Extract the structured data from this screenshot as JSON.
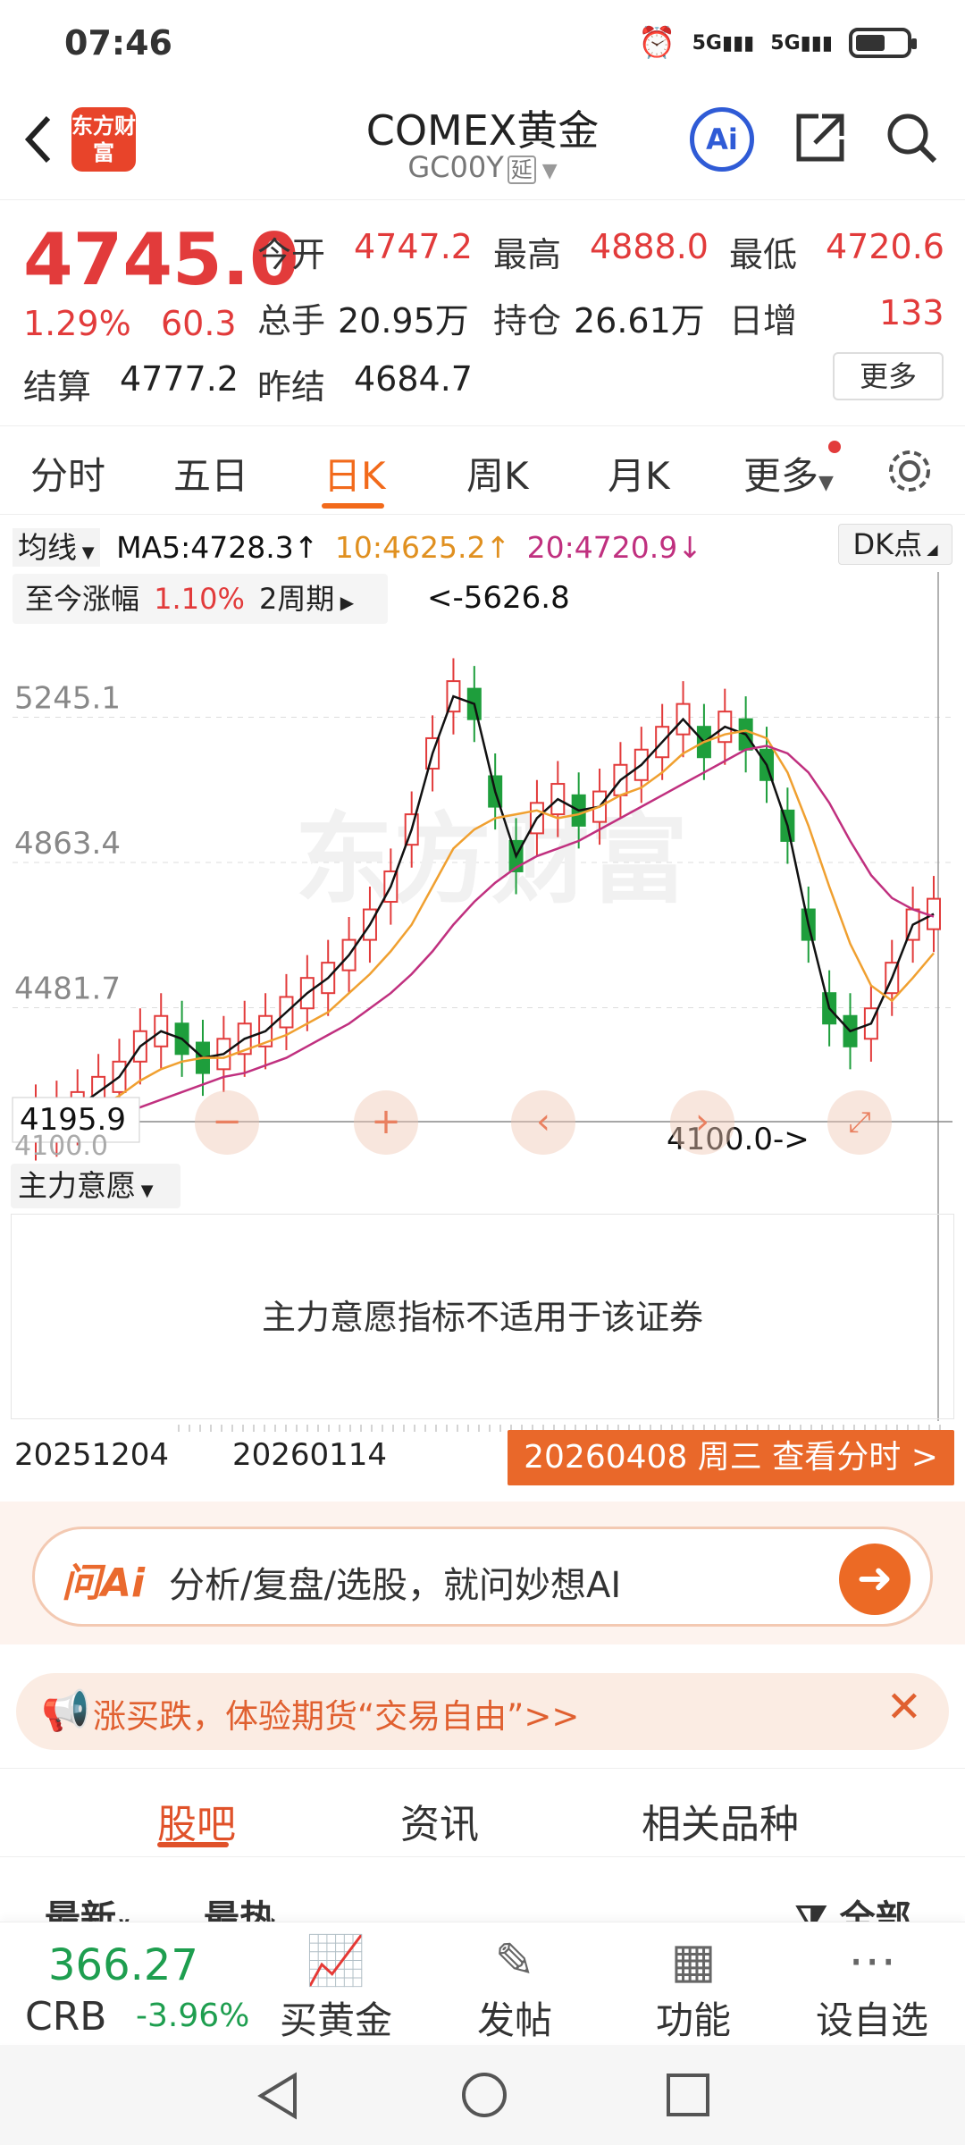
{
  "status_bar": {
    "time": "07:46",
    "network": "5G"
  },
  "nav": {
    "title": "COMEX黄金",
    "code": "GC00Y",
    "delay_tag": "延",
    "logo_text": "东方财富",
    "ai_label": "Ai"
  },
  "quote": {
    "price": "4745.0",
    "change_pct": "1.29%",
    "change": "60.3",
    "open_label": "今开",
    "open": "4747.2",
    "high_label": "最高",
    "high": "4888.0",
    "low_label": "最低",
    "low": "4720.6",
    "volume_label": "总手",
    "volume": "20.95万",
    "oi_label": "持仓",
    "oi": "26.61万",
    "daily_inc_label": "日增",
    "daily_inc": "133",
    "settle_label": "结算",
    "settle": "4777.2",
    "prev_settle_label": "昨结",
    "prev_settle": "4684.7",
    "more_label": "更多"
  },
  "period_tabs": [
    "分时",
    "五日",
    "日K",
    "周K",
    "月K",
    "更多"
  ],
  "active_period": "日K",
  "chart": {
    "ma_selector": "均线",
    "ma5": "MA5:4728.3",
    "ma10": "10:4625.2",
    "ma20": "20:4720.9",
    "dk_label": "DK点",
    "range_label": "至今涨幅",
    "range_pct": "1.10%",
    "range_period": "2周期",
    "max_annot": "<-5626.8",
    "min_annot": "4100.0->",
    "y_ticks": [
      "5245.1",
      "4863.4",
      "4481.7"
    ],
    "crosshair_value": "4195.9",
    "cut_tick": "4100.0",
    "colors": {
      "up": "#e23b3b",
      "down": "#1e9e3c",
      "ma5": "#111111",
      "ma10": "#f0a030",
      "ma20": "#c0307f"
    }
  },
  "chart_data": {
    "type": "candlestick",
    "title": "",
    "ylim": [
      4100.0,
      5626.8
    ],
    "series": [
      {
        "name": "MA5",
        "values": [
          4180,
          4190,
          4220,
          4260,
          4300,
          4380,
          4420,
          4400,
          4350,
          4360,
          4400,
          4420,
          4470,
          4520,
          4560,
          4620,
          4700,
          4800,
          4950,
          5150,
          5300,
          5280,
          5050,
          4880,
          4980,
          5030,
          5000,
          5010,
          5080,
          5120,
          5180,
          5240,
          5180,
          5220,
          5200,
          5120,
          4960,
          4700,
          4480,
          4420,
          4440,
          4560,
          4700,
          4728
        ]
      },
      {
        "name": "10",
        "values": [
          4150,
          4170,
          4190,
          4220,
          4250,
          4290,
          4320,
          4340,
          4350,
          4350,
          4370,
          4390,
          4410,
          4440,
          4470,
          4520,
          4570,
          4630,
          4700,
          4800,
          4900,
          4950,
          4980,
          4990,
          5000,
          4980,
          4990,
          5010,
          5040,
          5060,
          5100,
          5150,
          5180,
          5200,
          5210,
          5190,
          5100,
          4960,
          4800,
          4650,
          4540,
          4500,
          4560,
          4625
        ]
      },
      {
        "name": "20",
        "values": [
          4130,
          4140,
          4160,
          4180,
          4200,
          4220,
          4240,
          4260,
          4280,
          4300,
          4310,
          4330,
          4350,
          4380,
          4410,
          4440,
          4480,
          4520,
          4570,
          4630,
          4700,
          4760,
          4810,
          4850,
          4880,
          4900,
          4920,
          4950,
          4980,
          5010,
          5040,
          5070,
          5100,
          5130,
          5160,
          5170,
          5150,
          5100,
          5020,
          4920,
          4830,
          4770,
          4740,
          4721
        ]
      }
    ]
  },
  "indicator": {
    "selector": "主力意愿",
    "message": "主力意愿指标不适用于该证券"
  },
  "date_bar": {
    "start": "20251204",
    "mid": "20260114",
    "current": "20260408 周三 查看分时 >"
  },
  "ai_search": {
    "brand": "问Ai",
    "placeholder": "分析/复盘/选股，就问妙想AI"
  },
  "promo": {
    "text": "涨买跌，体验期货“交易自由”>>"
  },
  "bottom_tabs": [
    "股吧",
    "资讯",
    "相关品种"
  ],
  "active_bottom_tab": "股吧",
  "sort_options": [
    "最新",
    "最热",
    "全部"
  ],
  "bottom_bar": {
    "ticker_price": "366.27",
    "ticker_name": "CRB",
    "ticker_change": "-3.96%",
    "buttons": [
      "买黄金",
      "发帖",
      "功能",
      "设自选"
    ]
  }
}
